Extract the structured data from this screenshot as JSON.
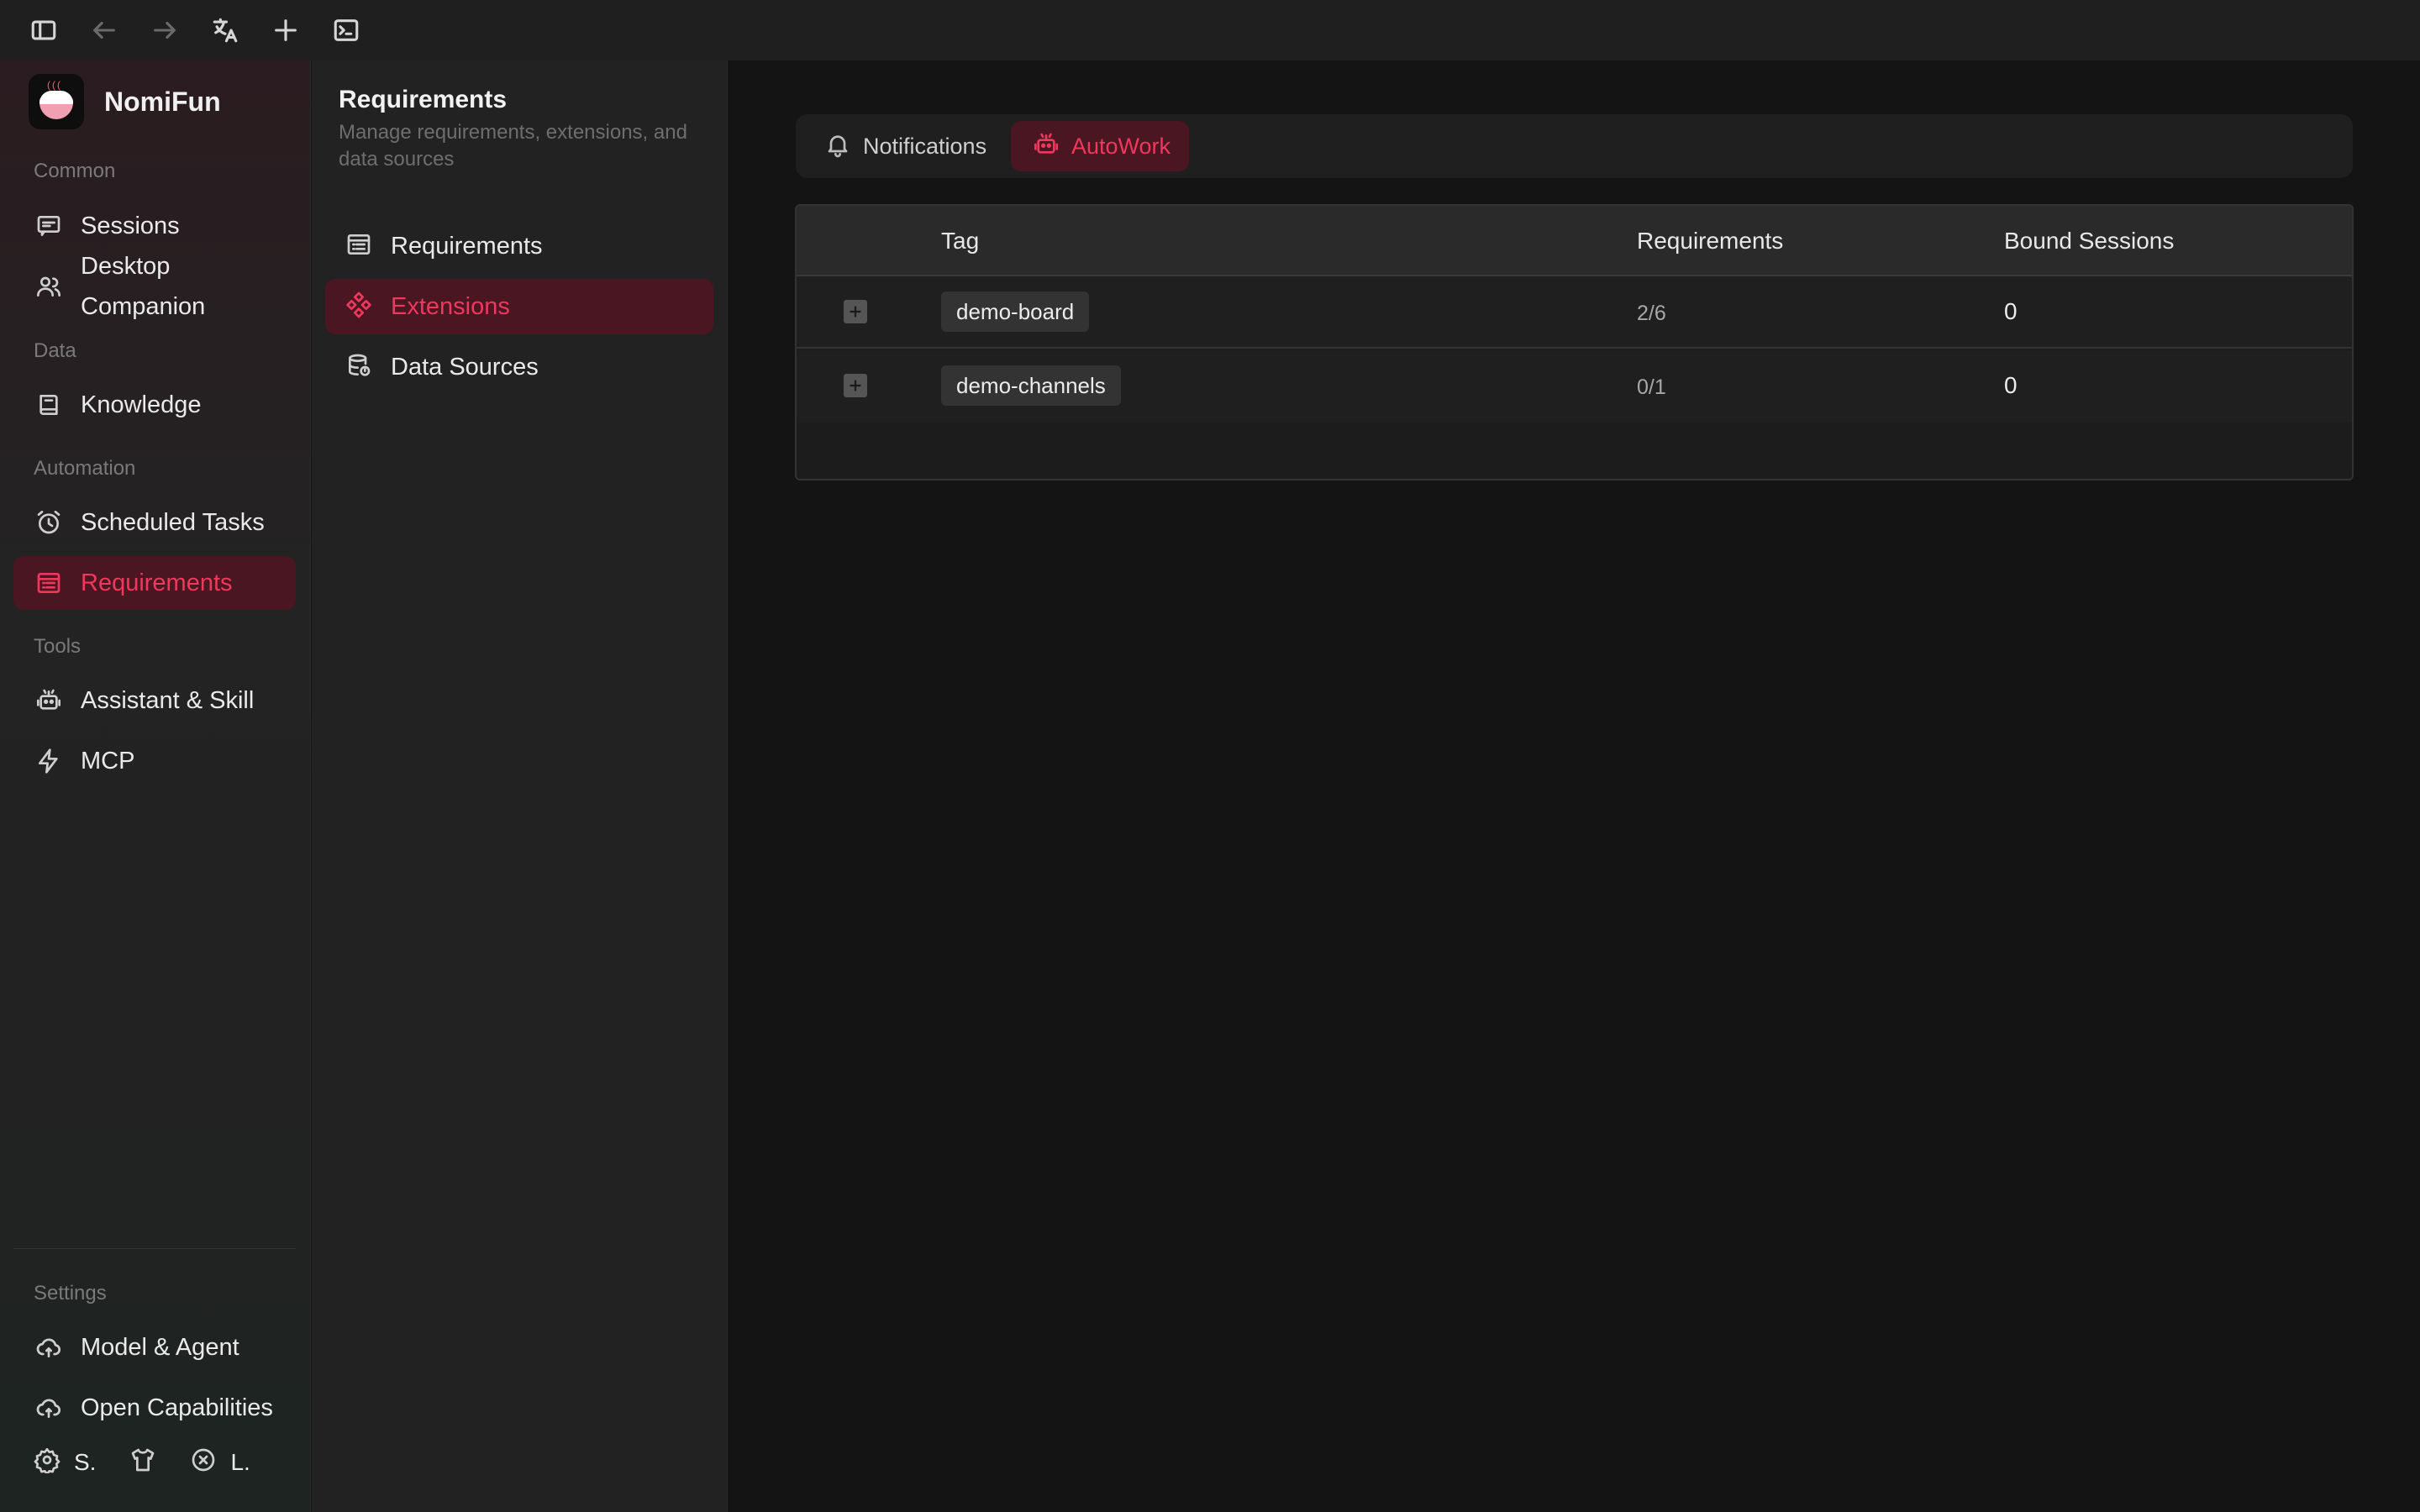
{
  "app": {
    "name": "NomiFun"
  },
  "sidebar": {
    "sections": [
      {
        "label": "Common"
      },
      {
        "label": "Data"
      },
      {
        "label": "Automation"
      },
      {
        "label": "Tools"
      },
      {
        "label": "Settings"
      }
    ],
    "items": [
      {
        "label": "Sessions",
        "icon": "chat-icon"
      },
      {
        "label": "Desktop Companion",
        "icon": "users-icon"
      },
      {
        "label": "Knowledge",
        "icon": "book-icon"
      },
      {
        "label": "Scheduled Tasks",
        "icon": "alarm-clock-icon"
      },
      {
        "label": "Requirements",
        "icon": "list-icon",
        "active": true
      },
      {
        "label": "Assistant & Skill",
        "icon": "robot-icon"
      },
      {
        "label": "MCP",
        "icon": "lightning-icon"
      },
      {
        "label": "Model & Agent",
        "icon": "cloud-icon"
      },
      {
        "label": "Open Capabilities",
        "icon": "cloud-icon"
      }
    ],
    "bottom": [
      {
        "label": "S.",
        "icon": "gear-icon"
      },
      {
        "label": "",
        "icon": "shirt-icon"
      },
      {
        "label": "L.",
        "icon": "close-circle-icon"
      }
    ]
  },
  "subpanel": {
    "title": "Requirements",
    "description": "Manage requirements, extensions, and data sources",
    "items": [
      {
        "label": "Requirements",
        "icon": "list-icon"
      },
      {
        "label": "Extensions",
        "icon": "extensions-icon",
        "active": true
      },
      {
        "label": "Data Sources",
        "icon": "database-icon"
      }
    ]
  },
  "main": {
    "tabs": [
      {
        "label": "Notifications",
        "icon": "bell-icon"
      },
      {
        "label": "AutoWork",
        "icon": "robot-icon",
        "active": true
      }
    ],
    "table": {
      "columns": [
        "Tag",
        "Requirements",
        "Bound Sessions"
      ],
      "rows": [
        {
          "tag": "demo-board",
          "requirements": "2/6",
          "bound_sessions": "0"
        },
        {
          "tag": "demo-channels",
          "requirements": "0/1",
          "bound_sessions": "0"
        }
      ]
    }
  },
  "colors": {
    "accent": "#f0375c",
    "active_bg": "#4a1622",
    "background": "#141414"
  }
}
